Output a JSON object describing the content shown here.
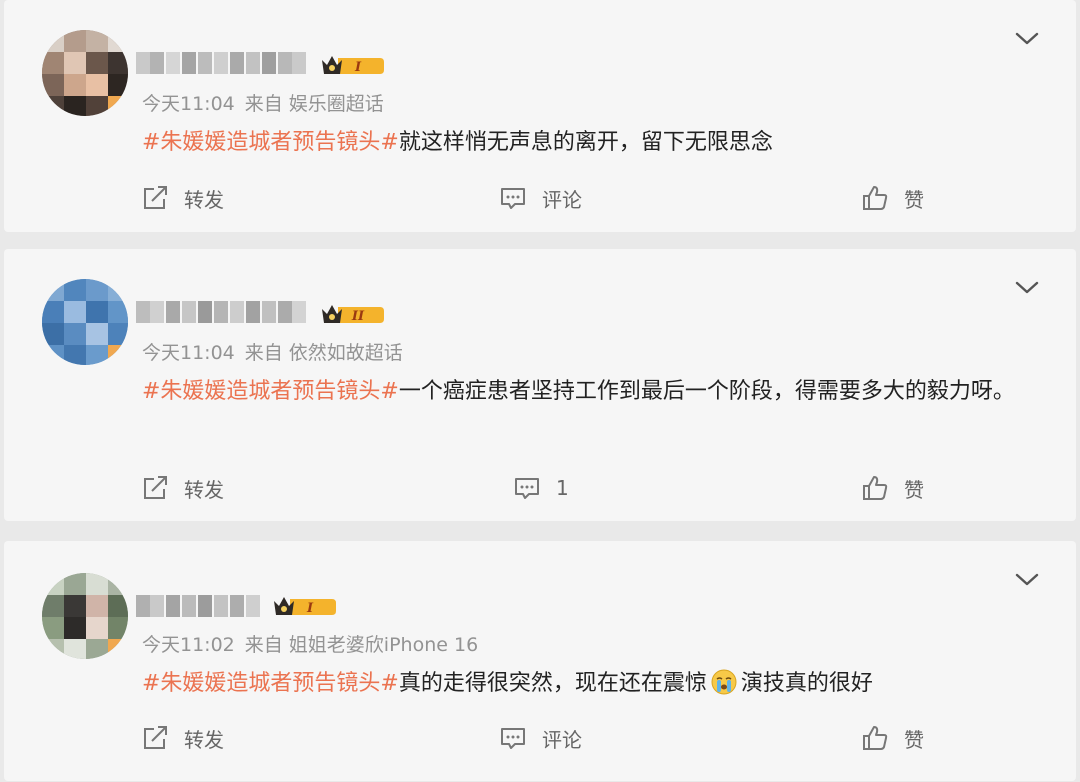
{
  "posts": [
    {
      "badge_level": "I",
      "time": "今天11:04",
      "source": "来自 娱乐圈超话",
      "topic": "#朱媛媛造城者预告镜头#",
      "text": "就这样悄无声息的离开，留下无限思念",
      "text_after_emoji": "",
      "forward_label": "转发",
      "comment_label": "评论",
      "like_label": "赞"
    },
    {
      "badge_level": "II",
      "time": "今天11:04",
      "source": "来自 依然如故超话",
      "topic": "#朱媛媛造城者预告镜头#",
      "text": "一个癌症患者坚持工作到最后一个阶段，得需要多大的毅力呀。",
      "text_after_emoji": "",
      "forward_label": "转发",
      "comment_label": "1",
      "like_label": "赞"
    },
    {
      "badge_level": "I",
      "time": "今天11:02",
      "source": "来自 姐姐老婆欣iPhone 16",
      "topic": "#朱媛媛造城者预告镜头#",
      "text": "真的走得很突然，现在还在震惊",
      "emoji": "crying-face-icon",
      "text_after_emoji": "演技真的很好",
      "forward_label": "转发",
      "comment_label": "评论",
      "like_label": "赞"
    }
  ],
  "colors": {
    "topic": "#eb7350",
    "meta": "#939393",
    "card_bg": "#f6f6f6",
    "page_bg": "#e9e9e9"
  }
}
